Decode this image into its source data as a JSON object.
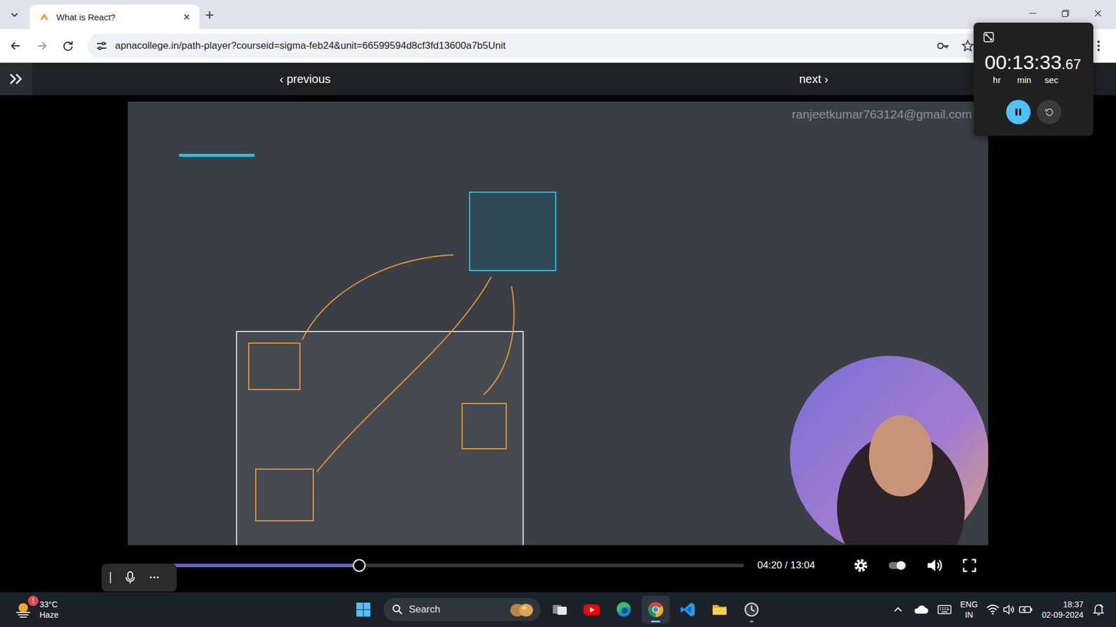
{
  "browser": {
    "tabs": [
      {
        "title": "What is React?",
        "close": "×",
        "selected": true
      }
    ],
    "new_tab": "+",
    "address": "apnacollege.in/path-player?courseid=sigma-feb24&unit=66599594d8cf3fd13600a7b5Unit"
  },
  "course_nav": {
    "previous": "‹ previous",
    "next": "next ›"
  },
  "video": {
    "watermark": "ranjeetkumar763124@gmail.com"
  },
  "player": {
    "progress": {
      "level": 0.36
    },
    "time": "04:20 / 13:04"
  },
  "voice_typing": {
    "more": "···"
  },
  "stopwatch": {
    "time": "00:13:33",
    "fraction": ".67",
    "units": [
      "hr",
      "min",
      "sec"
    ],
    "running": true
  },
  "taskbar": {
    "weather": {
      "temperature": "33°C",
      "condition": "Haze",
      "badge": "1"
    },
    "search": {
      "placeholder": "Search"
    },
    "apps": [
      {
        "kind": "taskview",
        "open": false,
        "focused": false
      },
      {
        "kind": "youtube",
        "open": false,
        "focused": false
      },
      {
        "kind": "edge",
        "open": false,
        "focused": false
      },
      {
        "kind": "chrome",
        "open": true,
        "focused": true
      },
      {
        "kind": "vscode",
        "open": false,
        "focused": false
      },
      {
        "kind": "explorer",
        "open": false,
        "focused": false
      },
      {
        "kind": "clock",
        "open": true,
        "focused": false
      }
    ],
    "tray": {
      "language": "ENG",
      "region": "IN",
      "time": "18:37",
      "date": "02-09-2024"
    }
  }
}
